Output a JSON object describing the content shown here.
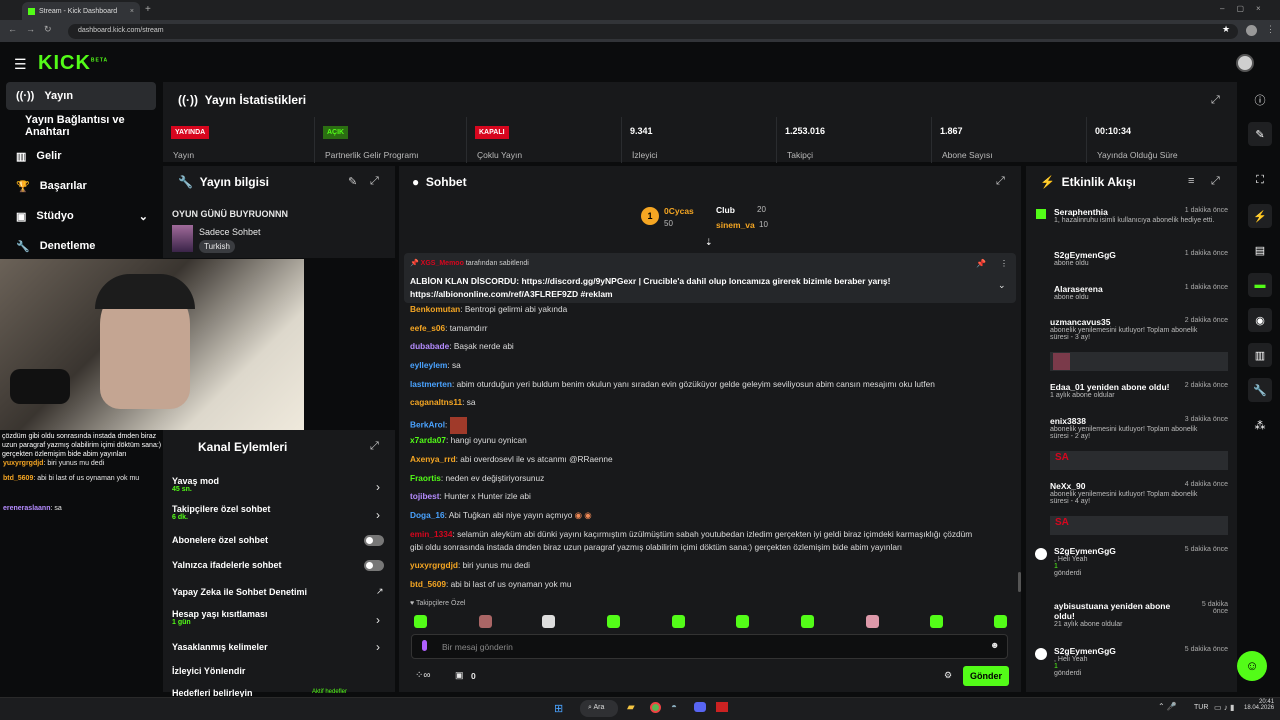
{
  "browser": {
    "tab_title": "Stream - Kick Dashboard",
    "url": "dashboard.kick.com/stream"
  },
  "logo": {
    "text": "KICK",
    "beta": "BETA"
  },
  "nav": [
    {
      "label": "Yayın",
      "icon": "broadcast-icon"
    },
    {
      "label": "Yayın Bağlantısı ve Anahtarı"
    },
    {
      "label": "Gelir",
      "icon": "chart-icon"
    },
    {
      "label": "Başarılar",
      "icon": "trophy-icon"
    },
    {
      "label": "Stüdyo",
      "icon": "studio-icon"
    },
    {
      "label": "Denetleme",
      "icon": "wrench-icon"
    }
  ],
  "stats": {
    "title": "Yayın İstatistikleri",
    "cells": [
      {
        "badge": "YAYINDA",
        "label": "Yayın",
        "color": "#d7061e"
      },
      {
        "badge": "AÇIK",
        "label": "Partnerlik Gelir Programı",
        "color": "#53fc18"
      },
      {
        "badge": "KAPALI",
        "label": "Çoklu Yayın",
        "color": "#d7061e"
      },
      {
        "value": "9.341",
        "label": "İzleyici"
      },
      {
        "value": "1.253.016",
        "label": "Takipçi"
      },
      {
        "value": "1.867",
        "label": "Abone Sayısı"
      },
      {
        "value": "00:10:34",
        "label": "Yayında Olduğu Süre"
      }
    ]
  },
  "info": {
    "title": "Yayın bilgisi",
    "stream_title": "OYUN GÜNÜ BUYRUONNN",
    "category": "Sadece Sohbet",
    "tag": "Turkish"
  },
  "overlay_chat": [
    {
      "user": "yuxyrgrgdjd",
      "text": "biri yunus mu dedi"
    },
    {
      "user": "btd_5609",
      "text": "abi bi last of us oynaman yok mu"
    },
    {
      "user": "ereneraslaann",
      "text": "sa"
    },
    {
      "user": "",
      "text": "çözdüm gibi oldu sonrasında instada dmden biraz uzun paragraf yazmış olabilirim içimi döktüm sana:) gerçekten özlemişim bide abim yayınları"
    }
  ],
  "actions": {
    "title": "Kanal Eylemleri",
    "rows": [
      {
        "label": "Yavaş mod",
        "value": "45 sn."
      },
      {
        "label": "Takipçilere özel sohbet",
        "value": "6 dk."
      },
      {
        "label": "Abonelere özel sohbet"
      },
      {
        "label": "Yalnızca ifadelerle sohbet"
      },
      {
        "label": "Yapay Zeka ile Sohbet Denetimi"
      },
      {
        "label": "Hesap yaşı kısıtlaması",
        "value": "1 gün"
      },
      {
        "label": "Yasaklanmış kelimeler"
      },
      {
        "label": "İzleyici Yönlendir"
      },
      {
        "label": "Hedefleri belirleyin",
        "value": "Aktif hedefler"
      }
    ]
  },
  "chat": {
    "title": "Sohbet",
    "leaders": [
      {
        "name": "0Cycas",
        "count": "50"
      },
      {
        "name": "Club",
        "count": "20"
      },
      {
        "name": "sinem_va",
        "count": "10"
      }
    ],
    "pinned_by": "tarafından sabitlendi",
    "pinned_user": "XGS_Memoo",
    "pinned_text": "ALBİON KLAN DİSCORDU: https://discord.gg/9yNPGexr | Crucible'a dahil olup loncamıza girerek bizimle beraber yarış!",
    "pinned_text2": "https://albiononline.com/ref/A3FLREF9ZD #reklam",
    "messages": [
      {
        "user": "Benkomutan",
        "text": "Bentropi gelirmi abi yakında",
        "color": "#f5a623"
      },
      {
        "user": "eefe_s06",
        "text": "tamamdırr",
        "color": "#f5a623"
      },
      {
        "user": "dubabade",
        "text": "Başak nerde abi",
        "color": "#b58cff"
      },
      {
        "user": "eylleylem",
        "text": "sa",
        "color": "#4aa3ff"
      },
      {
        "user": "lastmerten",
        "text": "abim oturduğun yeri buldum benim okulun yanı sıradan evin gözüküyor gelde geleyim seviliyosun abim cansın mesajımı oku lutfen",
        "color": "#4aa3ff"
      },
      {
        "user": "caganaltns11",
        "text": "sa",
        "color": "#f5a623"
      },
      {
        "user": "BerkArol",
        "text": "",
        "color": "#4aa3ff"
      },
      {
        "user": "x7arda07",
        "text": "hangi oyunu oynican",
        "color": "#53fc18"
      },
      {
        "user": "Axenya_rrd",
        "text": "abi overdosevl ile vs atcanmı @RRaenne",
        "color": "#f5a623"
      },
      {
        "user": "Fraortis",
        "text": "neden ev değiştiriyorsunuz",
        "color": "#53fc18"
      },
      {
        "user": "tojibest",
        "text": "Hunter x Hunter izle abi",
        "color": "#b58cff"
      },
      {
        "user": "Doga_16",
        "text": "Abi Tuğkan abi niye yayın açmıyo",
        "color": "#4aa3ff"
      },
      {
        "user": "emin_1334",
        "text": "selamün aleyküm abi dünki yayını kaçırmıştım üzülmüştüm sabah youtubedan izledim gerçekten iyi geldi biraz içimdeki karmaşıklığı çözdüm",
        "color": "#d7061e"
      },
      {
        "user": "",
        "text": "gibi oldu sonrasında instada dmden biraz uzun paragraf yazmış olabilirim içimi döktüm sana:) gerçekten özlemişim bide abim yayınları",
        "color": "#ddd"
      },
      {
        "user": "yuxyrgrgdjd",
        "text": "biri yunus mu dedi",
        "color": "#f5a623"
      },
      {
        "user": "btd_5609",
        "text": "abi bi last of us oynaman yok mu",
        "color": "#f5a623"
      }
    ],
    "followers_only": "Takipçilere Özel",
    "placeholder": "Bir mesaj gönderin",
    "send": "Gönder",
    "count": "0"
  },
  "activity": {
    "title": "Etkinlik Akışı",
    "items": [
      {
        "user": "Seraphenthia",
        "sub": "1, hazalinruhu isimli kullanıcıya abonelik hediye etti.",
        "time": "1 dakika önce"
      },
      {
        "user": "S2gEymenGgG",
        "sub": "abone oldu",
        "time": "1 dakika önce"
      },
      {
        "user": "Alaraserena",
        "sub": "abone oldu",
        "time": "1 dakika önce"
      },
      {
        "user": "uzmancavus35",
        "sub": "abonelik yenilemesini kutluyor! Toplam abonelik süresi - 3 ay!",
        "time": "2 dakika önce"
      },
      {
        "user": "Edaa_01 yeniden abone oldu!",
        "sub": "1 aylık abone oldular",
        "time": "2 dakika önce"
      },
      {
        "user": "enix3838",
        "sub": "abonelik yenilemesini kutluyor! Toplam abonelik süresi - 2 ay!",
        "time": "3 dakika önce"
      },
      {
        "user": "NeXx_90",
        "sub": "abonelik yenilemesini kutluyor! Toplam abonelik süresi - 4 ay!",
        "time": "4 dakika önce"
      },
      {
        "user": "S2gEymenGgG",
        "sub": ", Heli Yeah",
        "time": "5 dakika önce"
      },
      {
        "user": "aybisustuana yeniden abone oldu!",
        "sub": "21 aylık abone oldular",
        "time": "5 dakika önce"
      },
      {
        "user": "S2gEymenGgG",
        "sub": ", Heli Yeah",
        "time": "5 dakika önce"
      }
    ],
    "sa": "SA",
    "gift_label": "1",
    "gonderdi": "gönderdi"
  },
  "taskbar": {
    "search": "Ara",
    "lang": "TUR",
    "time": "20:41",
    "date": "18.04.2026"
  }
}
